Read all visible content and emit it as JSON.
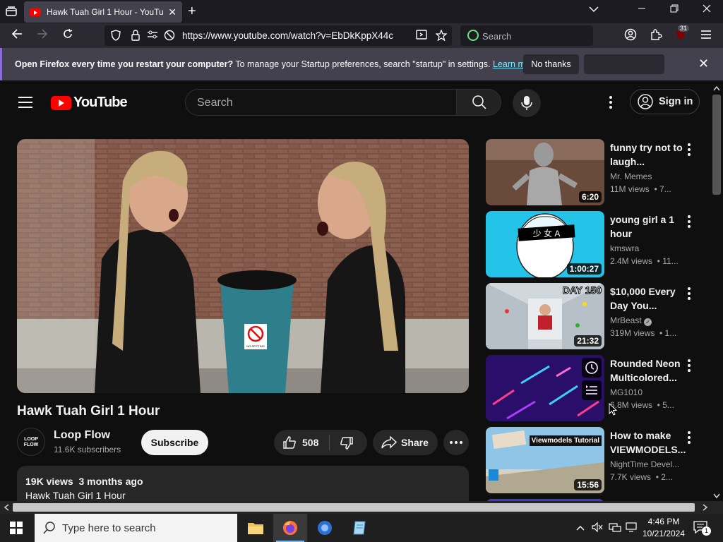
{
  "browser": {
    "tab_title": "Hawk Tuah Girl 1 Hour - YouTube",
    "url": "https://www.youtube.com/watch?v=EbDkKppX44c",
    "search_placeholder": "Search",
    "extension_badge": "31"
  },
  "notification": {
    "bold_text": "Open Firefox every time you restart your computer?",
    "text": " To manage your Startup preferences, search \"startup\" in settings. ",
    "link": "Learn more",
    "no_thanks": "No thanks"
  },
  "youtube": {
    "logo_text": "YouTube",
    "search_placeholder": "Search",
    "sign_in": "Sign in",
    "video": {
      "sign_text": "NO SPITTING",
      "title": "Hawk Tuah Girl 1 Hour",
      "channel": "Loop Flow",
      "channel_avatar": "LOOP FLOW",
      "subscribers": "11.6K subscribers",
      "subscribe": "Subscribe",
      "likes": "508",
      "share": "Share",
      "views_date": "19K views  3 months ago",
      "description": "Hawk Tuah Girl 1 Hour"
    },
    "recommendations": [
      {
        "title": "funny try not to laugh...",
        "channel": "Mr. Memes",
        "meta": "11M views  • 7...",
        "duration": "6:20"
      },
      {
        "title": "young girl a 1 hour",
        "channel": "kmswra",
        "meta": "2.4M views  • 11...",
        "duration": "1:00:27"
      },
      {
        "title": "$10,000 Every Day You...",
        "channel": "MrBeast",
        "meta": "319M views  • 1...",
        "duration": "21:32",
        "thumb_text": "DAY 150"
      },
      {
        "title": "Rounded Neon Multicolored...",
        "channel": "MG1010",
        "meta": "6.8M views  • 5...",
        "duration": ""
      },
      {
        "title": "How to make VIEWMODELS...",
        "channel": "NightTime Devel...",
        "meta": "7.7K views  • 2...",
        "duration": "15:56",
        "thumb_text": "Viewmodels Tutorial"
      }
    ]
  },
  "taskbar": {
    "search_placeholder": "Type here to search",
    "time": "4:46 PM",
    "date": "10/21/2024",
    "notification_count": "1"
  }
}
